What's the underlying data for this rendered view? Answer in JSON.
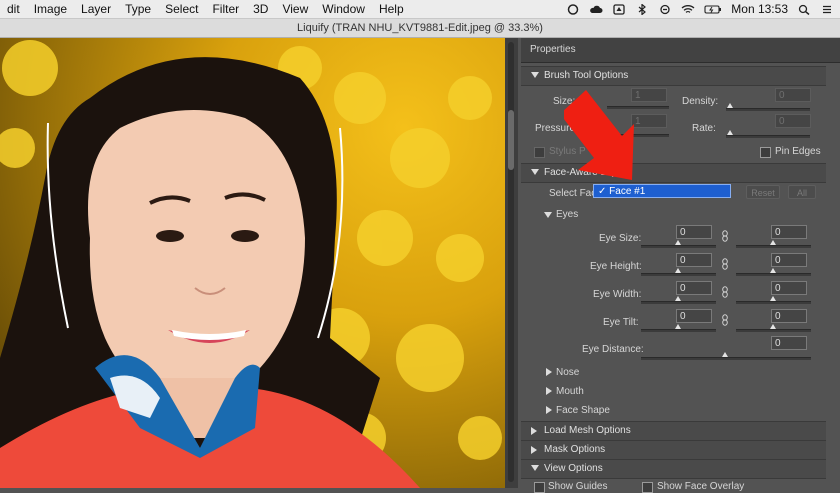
{
  "menubar": {
    "items": [
      "dit",
      "Image",
      "Layer",
      "Type",
      "Select",
      "Filter",
      "3D",
      "View",
      "Window",
      "Help"
    ],
    "clock": "Mon 13:53"
  },
  "window": {
    "title": "Liquify (TRAN NHU_KVT9881-Edit.jpeg @ 33.3%)"
  },
  "panel": {
    "title": "Properties",
    "brush": {
      "header": "Brush Tool Options",
      "size_label": "Size:",
      "size_value": "1",
      "density_label": "Density:",
      "density_value": "0",
      "pressure_label": "Pressure:",
      "pressure_value": "1",
      "rate_label": "Rate:",
      "rate_value": "0",
      "stylus_label": "Stylus P",
      "pin_edges_label": "Pin Edges"
    },
    "face": {
      "header": "Face-Aware Liqu",
      "select_face_label": "Select Face",
      "selected_face": "✓ Face #1",
      "reset_label": "Reset",
      "all_label": "All",
      "eyes_label": "Eyes",
      "eye_size_label": "Eye Size:",
      "eye_height_label": "Eye Height:",
      "eye_width_label": "Eye Width:",
      "eye_tilt_label": "Eye Tilt:",
      "eye_distance_label": "Eye Distance:",
      "eye_size_left": "0",
      "eye_size_right": "0",
      "eye_height_left": "0",
      "eye_height_right": "0",
      "eye_width_left": "0",
      "eye_width_right": "0",
      "eye_tilt_left": "0",
      "eye_tilt_right": "0",
      "eye_distance_value": "0",
      "nose_label": "Nose",
      "mouth_label": "Mouth",
      "face_shape_label": "Face Shape"
    },
    "load_mesh": "Load Mesh Options",
    "mask": "Mask Options",
    "view": {
      "header": "View Options",
      "show_guides": "Show Guides",
      "show_face_overlay": "Show Face Overlay"
    }
  }
}
